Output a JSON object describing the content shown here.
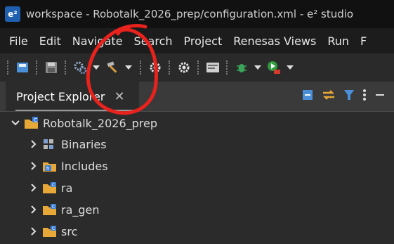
{
  "window": {
    "logo_text": "e²",
    "title": "workspace - Robotalk_2026_prep/configuration.xml - e² studio"
  },
  "menu": [
    "File",
    "Edit",
    "Navigate",
    "Search",
    "Project",
    "Renesas Views",
    "Run",
    "F"
  ],
  "toolbar_icons": [
    "save-all-icon",
    "save-icon",
    "build-config-icon",
    "hammer-icon",
    "gear-icon",
    "gear-icon",
    "console-icon",
    "debug-bug-icon",
    "run-icon"
  ],
  "view": {
    "tab_label": "Project Explorer",
    "close_glyph": "✕"
  },
  "tree": {
    "root": "Robotalk_2026_prep",
    "children": [
      "Binaries",
      "Includes",
      "ra",
      "ra_gen",
      "src"
    ]
  },
  "colors": {
    "annotation_circle": "#e8221c",
    "titlebar": "#111111",
    "folder": "#e8a838"
  }
}
